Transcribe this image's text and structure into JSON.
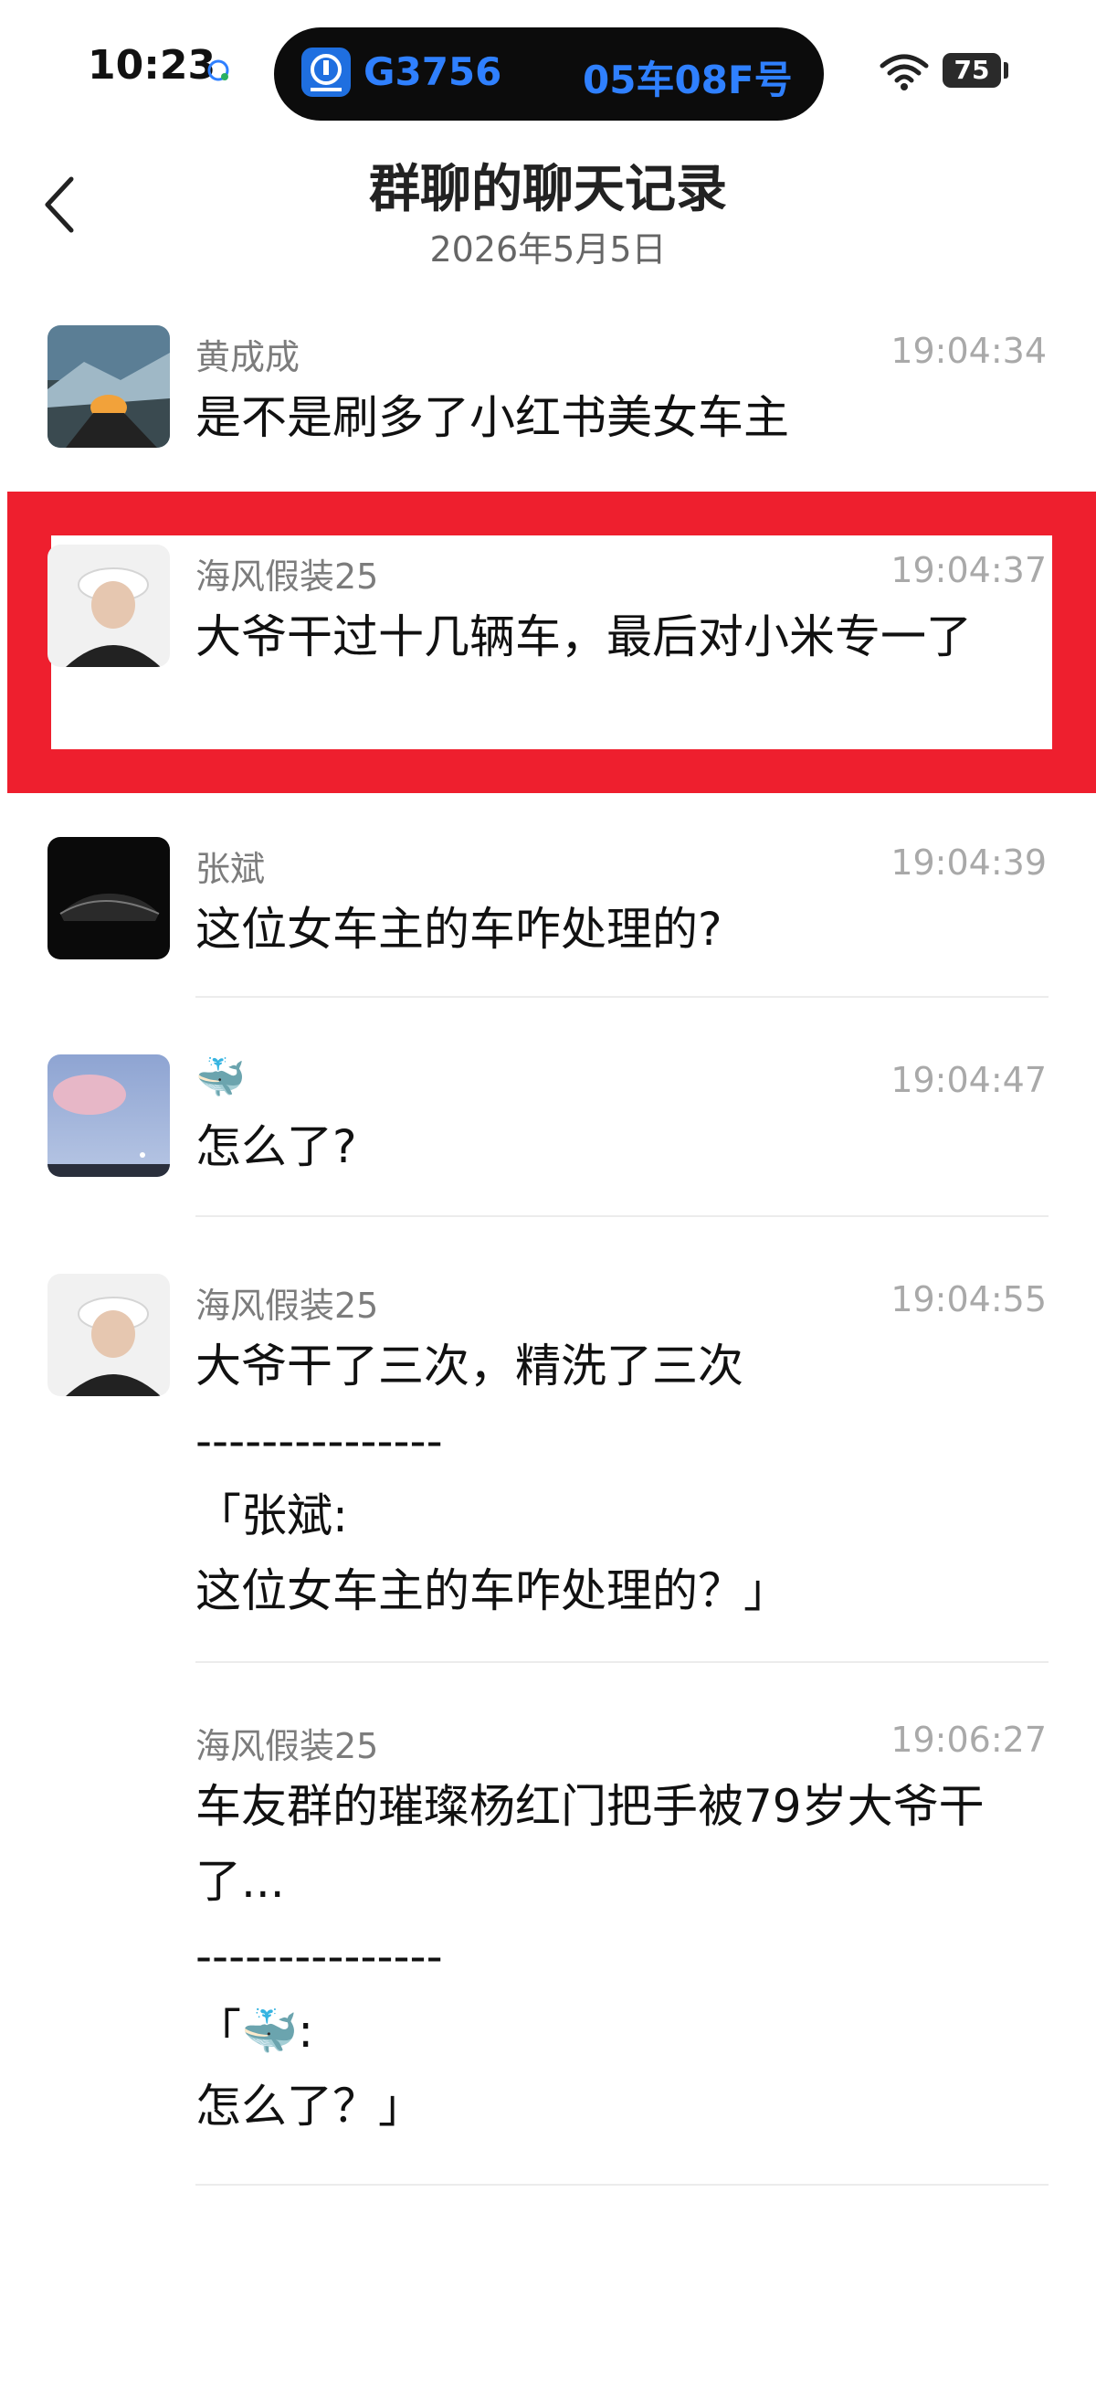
{
  "status": {
    "time": "10:23",
    "train_no": "G3756",
    "seat": "05车08F号",
    "battery": "75"
  },
  "header": {
    "title": "群聊的聊天记录",
    "date": "2026年5月5日"
  },
  "messages": [
    {
      "sender": "黄成成",
      "time": "19:04:34",
      "text": "是不是刷多了小红书美女车主"
    },
    {
      "sender": "海风假装25",
      "time": "19:04:37",
      "text": "大爷干过十几辆车，最后对小米专一了"
    },
    {
      "sender": "张斌",
      "time": "19:04:39",
      "text": "这位女车主的车咋处理的?"
    },
    {
      "sender": "🐳",
      "time": "19:04:47",
      "text": "怎么了?"
    },
    {
      "sender": "海风假装25",
      "time": "19:04:55",
      "text": "大爷干了三次，精洗了三次",
      "separator": "---------------",
      "quote_head": "「张斌:",
      "quote_body": "这位女车主的车咋处理的？」"
    },
    {
      "sender": "海风假装25",
      "time": "19:06:27",
      "text": "车友群的璀璨杨红门把手被79岁大爷干了...",
      "separator": "---------------",
      "quote_head": "「🐳:",
      "quote_body": "怎么了？」"
    }
  ],
  "colors": {
    "highlight": "#ee1f2e",
    "island_text": "#2f80ff"
  }
}
